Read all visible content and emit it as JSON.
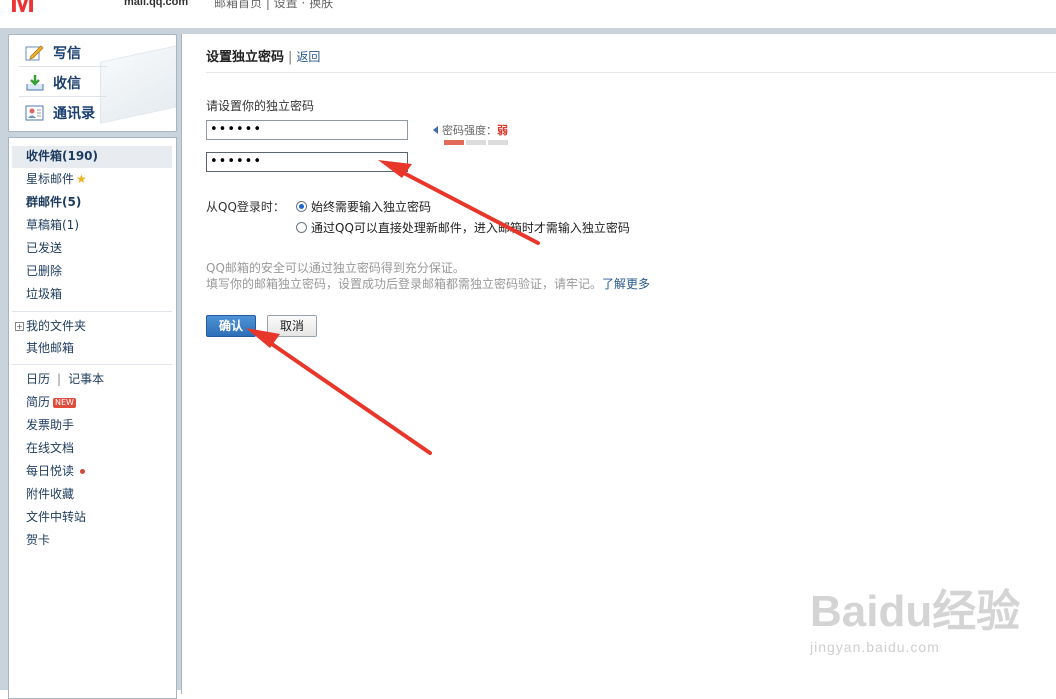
{
  "header": {
    "logo_text": "M",
    "domain": "mail.qq.com",
    "links": "邮箱首页 | 设置 · 换肤"
  },
  "quick": {
    "compose": "写信",
    "receive": "收信",
    "contacts": "通讯录"
  },
  "nav": {
    "inbox": "收件箱(190)",
    "starred": "星标邮件",
    "group": "群邮件(5)",
    "drafts": "草稿箱(1)",
    "sent": "已发送",
    "deleted": "已删除",
    "spam": "垃圾箱",
    "my_folders": "我的文件夹",
    "other_mailbox": "其他邮箱",
    "calendar": "日历",
    "notes": "记事本",
    "resume": "简历",
    "resume_badge": "NEW",
    "invoice": "发票助手",
    "docs": "在线文档",
    "daily_read": "每日悦读",
    "attachments": "附件收藏",
    "transfer": "文件中转站",
    "cards": "贺卡"
  },
  "main": {
    "title": "设置独立密码",
    "back": "返回",
    "prompt": "请设置你的独立密码",
    "password1": "••••••",
    "password2": "••••••",
    "strength_label": "密码强度：",
    "strength_value": "弱",
    "strength_level": 1,
    "strength_max": 3,
    "qq_login_label": "从QQ登录时：",
    "option_always": "始终需要输入独立密码",
    "option_direct": "通过QQ可以直接处理新邮件，进入邮箱时才需输入独立密码",
    "hint_line1": "QQ邮箱的安全可以通过独立密码得到充分保证。",
    "hint_line2": "填写你的邮箱独立密码，设置成功后登录邮箱都需独立密码验证，请牢记。",
    "learn_more": "了解更多",
    "confirm": "确认",
    "cancel": "取消"
  },
  "watermark": {
    "brand": "Bai",
    "brand2": "du",
    "brand_cn": "经验",
    "url": "jingyan.baidu.com"
  },
  "colors": {
    "accent": "#2d6fb8",
    "arrow": "#e8372a",
    "frame": "#c9d3dc"
  }
}
